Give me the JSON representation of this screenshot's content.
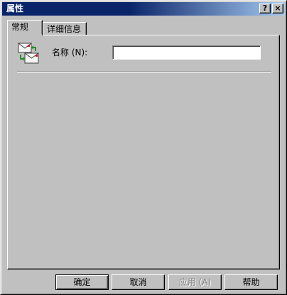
{
  "window": {
    "title": "属性"
  },
  "titlebar": {
    "help_glyph": "?",
    "close_glyph": "×"
  },
  "tabs": [
    {
      "label": "常规",
      "active": true
    },
    {
      "label": "详细信息",
      "active": false
    }
  ],
  "general": {
    "icon": "mail-properties-icon",
    "name_label": "名称 (N):",
    "name_value": ""
  },
  "buttons": {
    "ok": "确定",
    "cancel": "取消",
    "apply": "应用 (A)",
    "help": "帮助"
  },
  "colors": {
    "titlebar_start": "#0a246a",
    "titlebar_end": "#a6caf0",
    "face": "#c0c0c0"
  }
}
